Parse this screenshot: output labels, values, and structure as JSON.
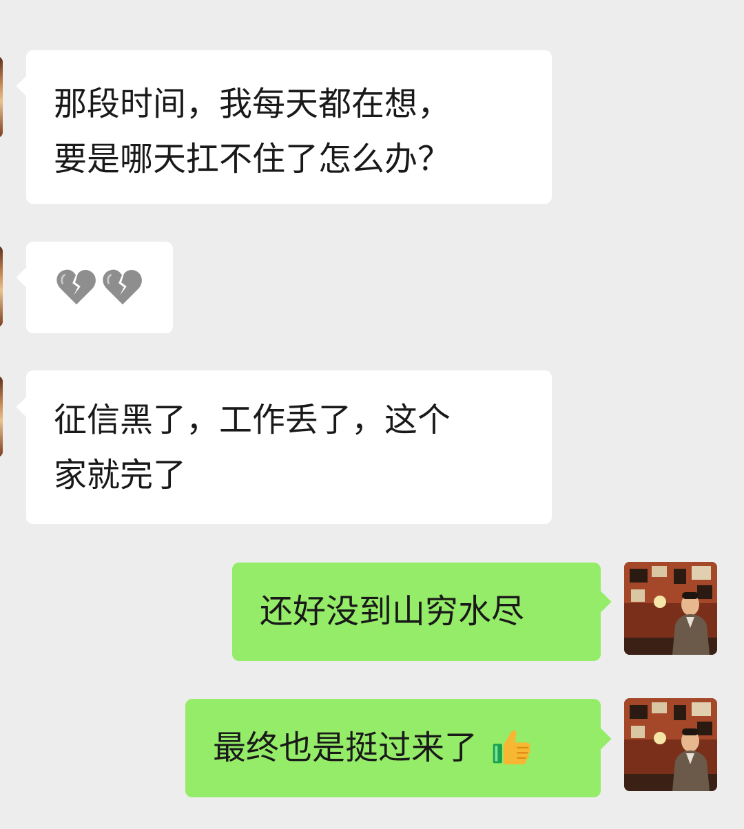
{
  "messages": [
    {
      "side": "left",
      "lines": [
        "那段时间，我每天都在想，",
        "要是哪天扛不住了怎么办？"
      ]
    },
    {
      "side": "left",
      "emoji": [
        "broken-heart-emoji",
        "broken-heart-emoji"
      ]
    },
    {
      "side": "left",
      "lines": [
        "征信黑了，工作丢了，这个",
        "家就完了"
      ]
    },
    {
      "side": "right",
      "text": "还好没到山穷水尽"
    },
    {
      "side": "right",
      "text": "最终也是挺过来了",
      "emoji": "thumbs-up-emoji"
    }
  ],
  "colors": {
    "background": "#ededed",
    "incoming_bubble": "#ffffff",
    "outgoing_bubble": "#95ec69",
    "text": "#191919"
  }
}
